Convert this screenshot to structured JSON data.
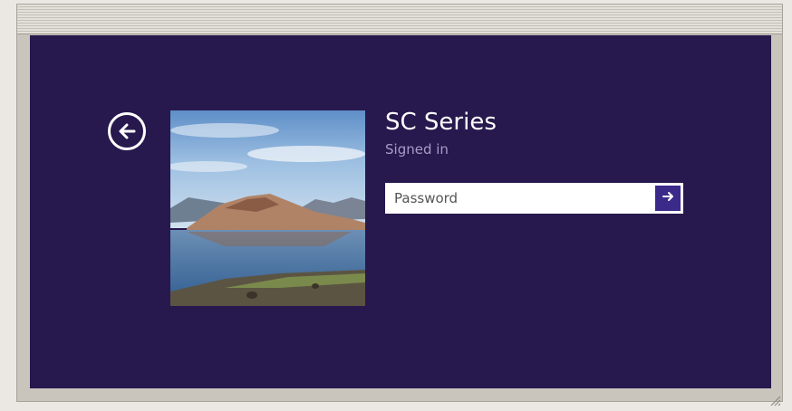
{
  "login": {
    "user_name": "SC Series",
    "status": "Signed in",
    "password_placeholder": "Password"
  },
  "icons": {
    "back": "back-arrow-circle-icon",
    "submit": "arrow-right-icon",
    "resize": "resize-grip-icon"
  },
  "colors": {
    "background": "#27184d",
    "status_text": "#a79cc8",
    "submit_button": "#3c2a8a"
  }
}
